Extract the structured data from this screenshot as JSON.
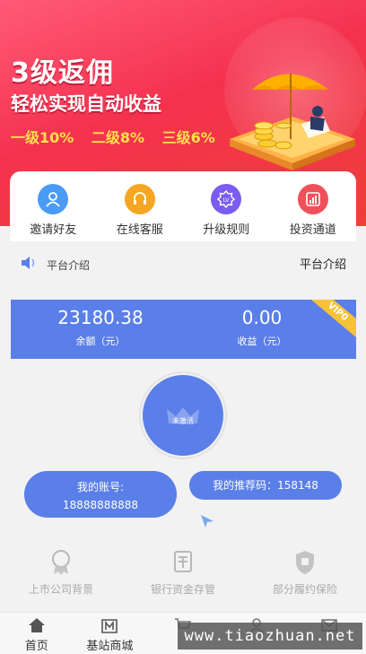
{
  "banner": {
    "title": "3级返佣",
    "subtitle": "轻松实现自动收益",
    "levels": [
      "一级10%",
      "二级8%",
      "三级6%"
    ]
  },
  "quick_actions": [
    {
      "label": "邀请好友",
      "icon": "user-icon",
      "color": "#4a9bf5"
    },
    {
      "label": "在线客服",
      "icon": "headset-icon",
      "color": "#f5a623"
    },
    {
      "label": "升级规则",
      "icon": "level-badge-icon",
      "color": "#7b5cf0"
    },
    {
      "label": "投资通道",
      "icon": "chart-icon",
      "color": "#f0505a"
    }
  ],
  "notice": {
    "text": "平台介绍",
    "right_label": "平台介绍"
  },
  "account": {
    "balance_value": "23180.38",
    "balance_label": "余额（元）",
    "income_value": "0.00",
    "income_label": "收益（元）",
    "vip_badge": "VIP0",
    "avatar_status": "未激活",
    "account_text": "我的账号:",
    "account_number": "18888888888",
    "referral_text": "我的推荐码：158148"
  },
  "features": [
    {
      "label": "上市公司背景",
      "icon": "certificate-icon"
    },
    {
      "label": "银行资金存管",
      "icon": "money-stack-icon"
    },
    {
      "label": "部分履约保险",
      "icon": "shield-icon"
    }
  ],
  "tabbar": [
    {
      "label": "首页",
      "icon": "home-icon"
    },
    {
      "label": "基站商城",
      "icon": "store-icon"
    },
    {
      "label": "",
      "icon": "cart-icon"
    },
    {
      "label": "",
      "icon": "profile-icon"
    },
    {
      "label": "",
      "icon": "mail-icon"
    }
  ],
  "watermark": "www.tiaozhuan.net",
  "colors": {
    "primary": "#5b7fe8",
    "banner_red": "#f4324e",
    "highlight_yellow": "#ffe04a",
    "vip_gold": "#f5c23a"
  }
}
